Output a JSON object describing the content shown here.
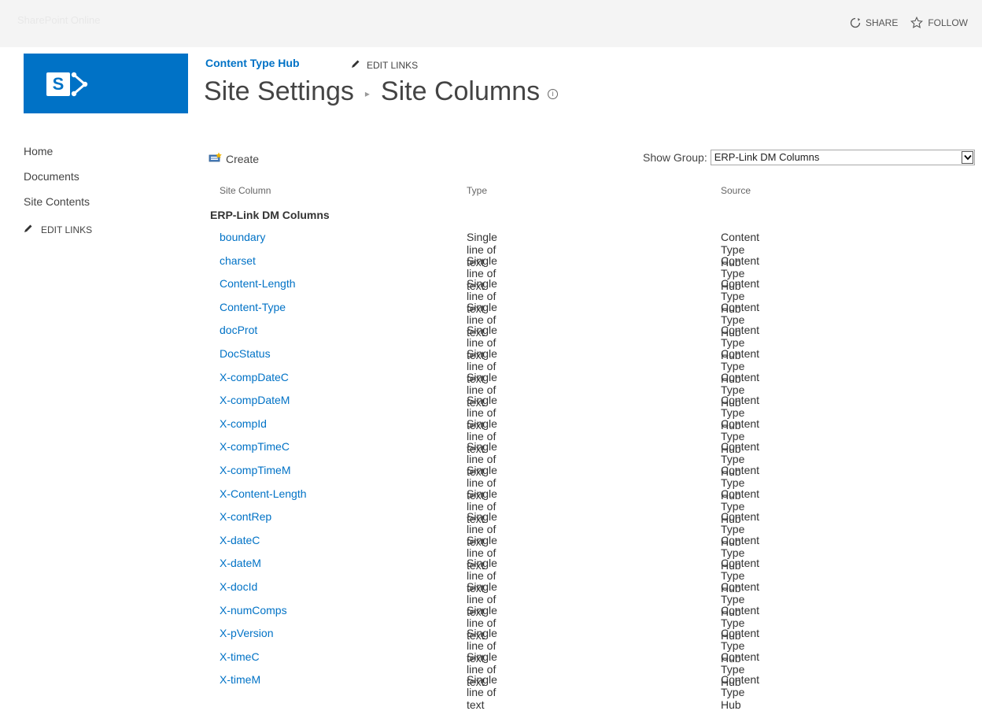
{
  "topbar": {
    "ghost_text": "SharePoint Online",
    "share_label": "SHARE",
    "follow_label": "FOLLOW"
  },
  "site": {
    "hub_link": "Content Type Hub",
    "edit_links": "EDIT LINKS",
    "title_part1": "Site Settings",
    "title_part2": "Site Columns"
  },
  "leftnav": {
    "items": [
      "Home",
      "Documents",
      "Site Contents"
    ],
    "edit_links": "EDIT LINKS"
  },
  "toolbar": {
    "create_label": "Create",
    "show_group_label": "Show Group:",
    "show_group_value": "ERP-Link DM Columns"
  },
  "table": {
    "headers": [
      "Site Column",
      "Type",
      "Source"
    ],
    "group": "ERP-Link DM Columns",
    "rows": [
      {
        "name": "boundary",
        "type": "Single line of text",
        "source": "Content Type Hub"
      },
      {
        "name": "charset",
        "type": "Single line of text",
        "source": "Content Type Hub"
      },
      {
        "name": "Content-Length",
        "type": "Single line of text",
        "source": "Content Type Hub"
      },
      {
        "name": "Content-Type",
        "type": "Single line of text",
        "source": "Content Type Hub"
      },
      {
        "name": "docProt",
        "type": "Single line of text",
        "source": "Content Type Hub"
      },
      {
        "name": "DocStatus",
        "type": "Single line of text",
        "source": "Content Type Hub"
      },
      {
        "name": "X-compDateC",
        "type": "Single line of text",
        "source": "Content Type Hub"
      },
      {
        "name": "X-compDateM",
        "type": "Single line of text",
        "source": "Content Type Hub"
      },
      {
        "name": "X-compId",
        "type": "Single line of text",
        "source": "Content Type Hub"
      },
      {
        "name": "X-compTimeC",
        "type": "Single line of text",
        "source": "Content Type Hub"
      },
      {
        "name": "X-compTimeM",
        "type": "Single line of text",
        "source": "Content Type Hub"
      },
      {
        "name": "X-Content-Length",
        "type": "Single line of text",
        "source": "Content Type Hub"
      },
      {
        "name": "X-contRep",
        "type": "Single line of text",
        "source": "Content Type Hub"
      },
      {
        "name": "X-dateC",
        "type": "Single line of text",
        "source": "Content Type Hub"
      },
      {
        "name": "X-dateM",
        "type": "Single line of text",
        "source": "Content Type Hub"
      },
      {
        "name": "X-docId",
        "type": "Single line of text",
        "source": "Content Type Hub"
      },
      {
        "name": "X-numComps",
        "type": "Single line of text",
        "source": "Content Type Hub"
      },
      {
        "name": "X-pVersion",
        "type": "Single line of text",
        "source": "Content Type Hub"
      },
      {
        "name": "X-timeC",
        "type": "Single line of text",
        "source": "Content Type Hub"
      },
      {
        "name": "X-timeM",
        "type": "Single line of text",
        "source": "Content Type Hub"
      }
    ]
  },
  "colors": {
    "brand_blue": "#0072c6",
    "topbar_bg": "#f4f4f4",
    "text": "#444444"
  }
}
